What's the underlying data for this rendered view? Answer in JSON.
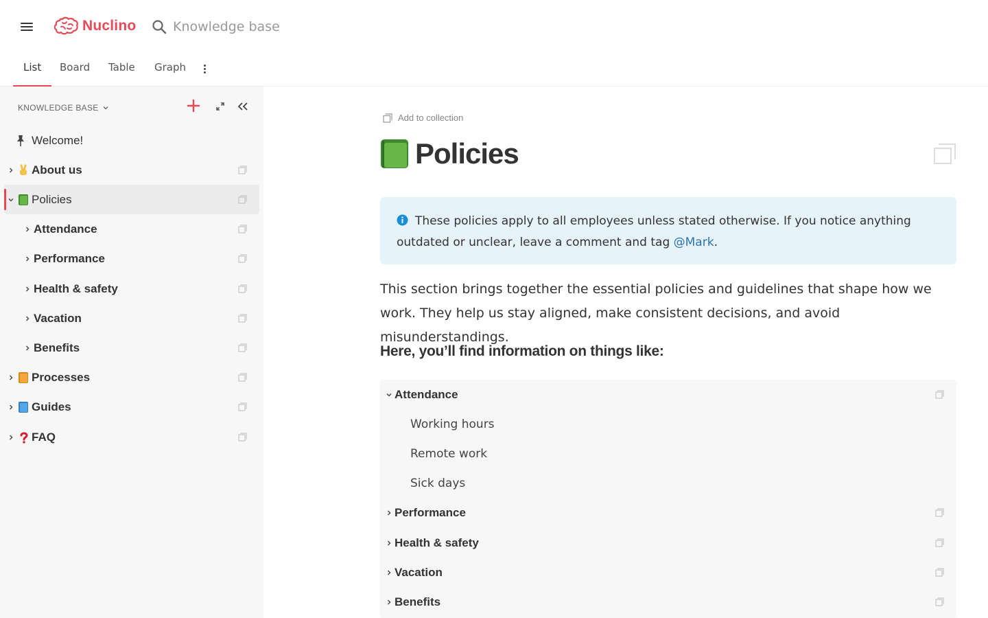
{
  "app": {
    "brand": "Nuclino",
    "brand_color": "#e84956",
    "search_placeholder": "Knowledge base"
  },
  "tabs": [
    {
      "label": "List",
      "active": true
    },
    {
      "label": "Board",
      "active": false
    },
    {
      "label": "Table",
      "active": false
    },
    {
      "label": "Graph",
      "active": false
    }
  ],
  "sidebar": {
    "header": "KNOWLEDGE BASE",
    "items": [
      {
        "label": "Welcome!",
        "icon": "pin-icon",
        "level": 0
      },
      {
        "label": "About us",
        "icon": "victory-hand-icon",
        "level": 0
      },
      {
        "label": "Policies",
        "icon": "green-book-icon",
        "level": 0,
        "selected": true,
        "expanded": true
      },
      {
        "label": "Attendance",
        "level": 1
      },
      {
        "label": "Performance",
        "level": 1
      },
      {
        "label": "Health & safety",
        "level": 1
      },
      {
        "label": "Vacation",
        "level": 1
      },
      {
        "label": "Benefits",
        "level": 1
      },
      {
        "label": "Processes",
        "icon": "orange-book-icon",
        "level": 0
      },
      {
        "label": "Guides",
        "icon": "blue-book-icon",
        "level": 0
      },
      {
        "label": "FAQ",
        "icon": "question-mark-icon",
        "level": 0
      }
    ]
  },
  "main": {
    "add_to_collection": "Add to collection",
    "title": "Policies",
    "callout": {
      "text": "These policies apply to all employees unless stated otherwise. If you notice anything outdated or unclear, leave a comment and tag ",
      "mention": "@Mark",
      "end": ".",
      "color": "#e7f3fb"
    },
    "intro": "This section brings together the essential policies and guidelines that shape how we work. They help us stay aligned, make consistent decisions, and avoid misunderstandings.",
    "subheading": "Here, you’ll find information on things like:",
    "outline": [
      {
        "label": "Attendance",
        "expanded": true,
        "children": [
          "Working hours",
          "Remote work",
          "Sick days"
        ]
      },
      {
        "label": "Performance"
      },
      {
        "label": "Health & safety"
      },
      {
        "label": "Vacation"
      },
      {
        "label": "Benefits"
      }
    ]
  }
}
